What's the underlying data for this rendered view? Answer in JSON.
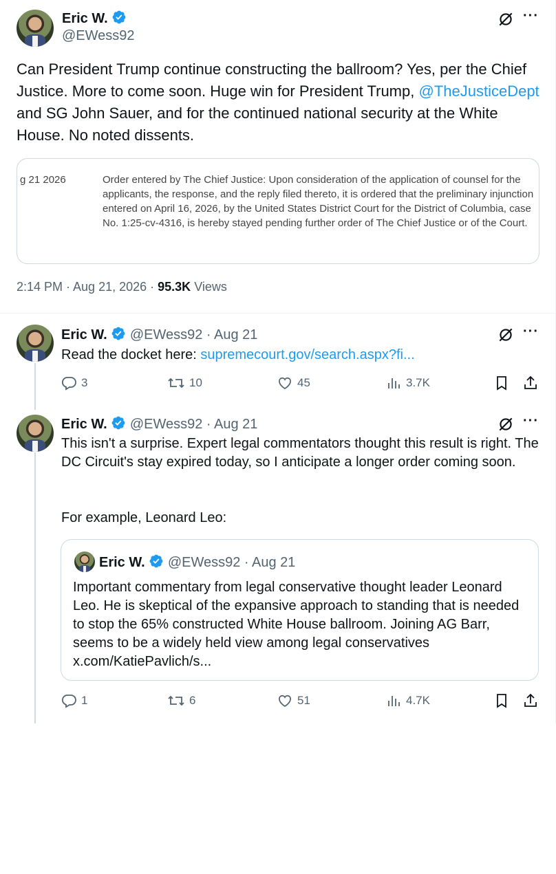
{
  "main_tweet": {
    "author_name": "Eric W.",
    "handle": "@EWess92",
    "text_before_link": "Can President Trump continue constructing the ballroom? Yes, per the Chief Justice. More to come soon. Huge win for President Trump, ",
    "mention": "@TheJusticeDept",
    "text_after_link": " and SG John Sauer, and for the continued national security at the White House. No noted dissents.",
    "doc_card": {
      "date": "g 21 2026",
      "order_text": "Order entered by The Chief Justice: Upon consideration of the application of counsel for the applicants, the response, and the reply filed thereto, it is ordered that the preliminary injunction entered on April 16, 2026, by the United States District Court for the District of Columbia, case No. 1:25-cv-4316, is hereby stayed pending further order of The Chief Justice or of the Court."
    },
    "timestamp": "2:14 PM · Aug 21, 2026 · ",
    "views_count": "95.3K",
    "views_label": " Views"
  },
  "reply1": {
    "author_name": "Eric W.",
    "meta": "@EWess92 · Aug 21",
    "text_prefix": "Read the docket here: ",
    "link": "supremecourt.gov/search.aspx?fi...",
    "stats": {
      "replies": "3",
      "reposts": "10",
      "likes": "45",
      "views": "3.7K"
    }
  },
  "reply2": {
    "author_name": "Eric W.",
    "meta": "@EWess92 · Aug 21",
    "paragraph1": "This isn't a surprise. Expert legal commentators thought this result is right. The DC Circuit's stay expired today, so I anticipate a longer order coming soon.",
    "paragraph2": "For example, Leonard Leo:",
    "quote": {
      "author_name": "Eric W.",
      "meta": "@EWess92 · Aug 21",
      "text": "Important commentary from legal conservative thought leader Leonard Leo. He is skeptical of the expansive approach to standing that is needed to stop the 65% constructed White House ballroom. Joining AG Barr, seems to be a widely held view among legal conservatives x.com/KatiePavlich/s..."
    },
    "stats": {
      "replies": "1",
      "reposts": "6",
      "likes": "51",
      "views": "4.7K"
    }
  },
  "colors": {
    "accent": "#1d9bf0",
    "text": "#0f1419",
    "muted": "#536471",
    "border": "#cfd9de"
  },
  "icons": [
    "verified-badge-icon",
    "grok-icon",
    "more-icon",
    "reply-icon",
    "repost-icon",
    "like-icon",
    "views-icon",
    "bookmark-icon",
    "share-icon"
  ]
}
